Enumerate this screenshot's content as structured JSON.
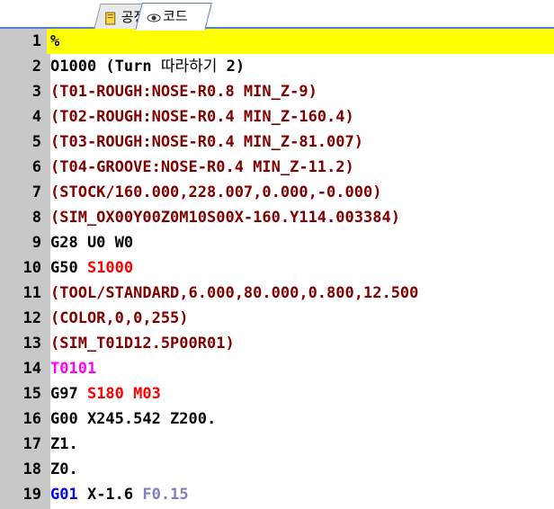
{
  "tabs": [
    {
      "label": "공정",
      "icon": "document-icon"
    },
    {
      "label": "코드",
      "icon": "eye-icon"
    }
  ],
  "lines": [
    {
      "n": "1",
      "segs": [
        {
          "t": "%",
          "c": ""
        }
      ],
      "highlight": true
    },
    {
      "n": "2",
      "segs": [
        {
          "t": "O1000 (Turn ",
          "c": ""
        },
        {
          "t": "따라하기",
          "c": "ko"
        },
        {
          "t": " 2)",
          "c": ""
        }
      ]
    },
    {
      "n": "3",
      "segs": [
        {
          "t": "(T01-ROUGH:NOSE-R0.8 MIN_Z-9)",
          "c": "comment"
        }
      ]
    },
    {
      "n": "4",
      "segs": [
        {
          "t": "(T02-ROUGH:NOSE-R0.4 MIN_Z-160.4)",
          "c": "comment"
        }
      ]
    },
    {
      "n": "5",
      "segs": [
        {
          "t": "(T03-ROUGH:NOSE-R0.4 MIN_Z-81.007)",
          "c": "comment"
        }
      ]
    },
    {
      "n": "6",
      "segs": [
        {
          "t": "(T04-GROOVE:NOSE-R0.4 MIN_Z-11.2)",
          "c": "comment"
        }
      ]
    },
    {
      "n": "7",
      "segs": [
        {
          "t": "(STOCK/160.000,228.007,0.000,-0.000)",
          "c": "comment"
        }
      ]
    },
    {
      "n": "8",
      "segs": [
        {
          "t": "(SIM_OX00Y00Z0M10S00X-160.Y114.003384)",
          "c": "comment"
        }
      ]
    },
    {
      "n": "9",
      "segs": [
        {
          "t": "G28 U0 W0",
          "c": ""
        }
      ]
    },
    {
      "n": "10",
      "segs": [
        {
          "t": "G50 ",
          "c": ""
        },
        {
          "t": "S1000",
          "c": "red"
        }
      ]
    },
    {
      "n": "11",
      "segs": [
        {
          "t": "(TOOL/STANDARD,6.000,80.000,0.800,12.500",
          "c": "comment"
        }
      ]
    },
    {
      "n": "12",
      "segs": [
        {
          "t": "(COLOR,0,0,255)",
          "c": "comment"
        }
      ]
    },
    {
      "n": "13",
      "segs": [
        {
          "t": "(SIM_T01D12.5P00R01)",
          "c": "comment"
        }
      ]
    },
    {
      "n": "14",
      "segs": [
        {
          "t": "T0101",
          "c": "mag"
        }
      ]
    },
    {
      "n": "15",
      "segs": [
        {
          "t": "G97 ",
          "c": ""
        },
        {
          "t": "S180",
          "c": "red"
        },
        {
          "t": " ",
          "c": ""
        },
        {
          "t": "M03",
          "c": "red"
        }
      ]
    },
    {
      "n": "16",
      "segs": [
        {
          "t": "G00 X245.542 Z200.",
          "c": ""
        }
      ]
    },
    {
      "n": "17",
      "segs": [
        {
          "t": "Z1.",
          "c": ""
        }
      ]
    },
    {
      "n": "18",
      "segs": [
        {
          "t": "Z0.",
          "c": ""
        }
      ]
    },
    {
      "n": "19",
      "segs": [
        {
          "t": "G01",
          "c": "blue"
        },
        {
          "t": " X-1.6 ",
          "c": ""
        },
        {
          "t": "F0.15",
          "c": "gray"
        }
      ]
    }
  ]
}
